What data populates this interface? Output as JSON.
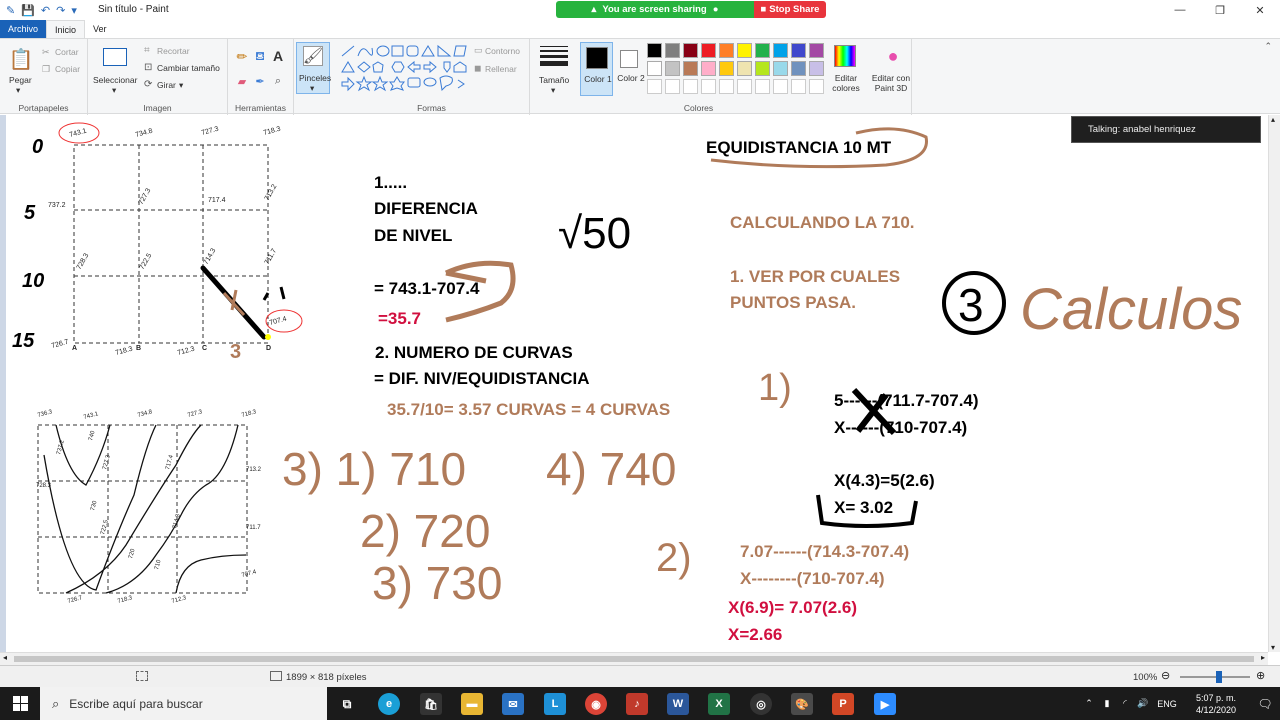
{
  "window": {
    "title": "Sin título - Paint",
    "controls": [
      "—",
      "❐",
      "✕"
    ]
  },
  "share_bar": {
    "status": "You are screen sharing",
    "stop": "Stop Share"
  },
  "tabs": [
    "Archivo",
    "Inicio",
    "Ver"
  ],
  "ribbon": {
    "portapapeles": {
      "paste": "Pegar",
      "cut": "Cortar",
      "copy": "Copiar",
      "label": "Portapapeles"
    },
    "imagen": {
      "select": "Seleccionar",
      "crop": "Recortar",
      "resize": "Cambiar tamaño",
      "rotate": "Girar",
      "label": "Imagen"
    },
    "herramientas": {
      "label": "Herramientas"
    },
    "pinceles": "Pinceles",
    "formas": {
      "outline": "Contorno",
      "fill": "Rellenar",
      "label": "Formas"
    },
    "tamano": "Tamaño",
    "color1": "Color 1",
    "color2": "Color 2",
    "colores": {
      "edit": "Editar colores",
      "paint3d": "Editar con Paint 3D",
      "label": "Colores"
    },
    "palette_row1": [
      "#000000",
      "#7f7f7f",
      "#880015",
      "#ed1c24",
      "#ff7f27",
      "#fff200",
      "#22b14c",
      "#00a2e8",
      "#3f48cc",
      "#a349a4"
    ],
    "palette_row2": [
      "#ffffff",
      "#c3c3c3",
      "#b97a57",
      "#ffaec9",
      "#ffc90e",
      "#efe4b0",
      "#b5e61d",
      "#99d9ea",
      "#7092be",
      "#c8bfe7"
    ]
  },
  "toast": "Talking: anabel henriquez",
  "canvas": {
    "topgrid": {
      "values": [
        "743.1",
        "734.8",
        "727.3",
        "718.3",
        "737.2",
        "727.3",
        "717.4",
        "713.2",
        "728.3",
        "722.5",
        "714.3",
        "711.7",
        "726.7",
        "718.3",
        "712.3",
        "707.4"
      ],
      "corners": [
        "A",
        "B",
        "C",
        "D"
      ],
      "side": [
        "0",
        "5",
        "10",
        "15"
      ],
      "mark": "3"
    },
    "bottomgrid": {
      "values": [
        "736.3",
        "743.1",
        "734.8",
        "727.3",
        "718.3",
        "737.2",
        "727.3",
        "717.4",
        "713.2",
        "728.3",
        "722.5",
        "714.3",
        "711.7",
        "726.7",
        "718.3",
        "712.3",
        "707.4"
      ],
      "contours": [
        "740",
        "730",
        "720",
        "710"
      ]
    },
    "text": {
      "l1": "1.....",
      "l2": "DIFERENCIA",
      "l3": "DE NIVEL",
      "l4": "= 743.1-707.4",
      "l5": "=35.7",
      "l6": "2. NUMERO DE CURVAS",
      "l7": "= DIF. NIV/EQUIDISTANCIA",
      "l8": "35.7/10= 3.57 CURVAS = 4 CURVAS",
      "eq": "EQUIDISTANCIA 10 MT",
      "calc": "CALCULANDO LA 710.",
      "ver1": "1. VER POR CUALES",
      "ver2": "PUNTOS PASA.",
      "f1": "5------(711.7-707.4)",
      "f2": "X------(710-707.4)",
      "f3": "X(4.3)=5(2.6)",
      "f4": "X= 3.02",
      "g1": "7.07------(714.3-707.4)",
      "g2": "X--------(710-707.4)",
      "g3": "X(6.9)= 7.07(2.6)",
      "g4": "X=2.66"
    },
    "handwriting": {
      "sqrt": "√50",
      "calculos": "Calculos",
      "three": "3",
      "h1": "3) 1) 710",
      "h2": "4) 740",
      "h3": "2) 720",
      "h4": "3) 730",
      "h5": "2)",
      "h6": "1)"
    }
  },
  "status": {
    "size": "1899 × 818 píxeles",
    "zoom": "100%"
  },
  "taskbar": {
    "search": "Escribe aquí para buscar",
    "lang": "ENG",
    "time": "5:07 p. m.",
    "date": "4/12/2020"
  }
}
